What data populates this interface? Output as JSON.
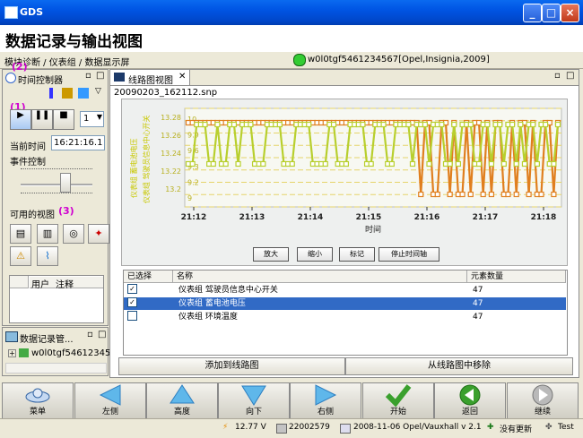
{
  "window": {
    "title": "GDS",
    "minimize": "_",
    "maximize": "□",
    "close": "×"
  },
  "app": {
    "title": "数据记录与输出视图",
    "breadcrumb": "模块诊断 / 仪表组 / 数据显示屏",
    "vehicle": "w0l0tgf5461234567[Opel,Insignia,2009]"
  },
  "timer_panel": {
    "tab_label": "时间控制器",
    "callout_1": "(1)",
    "callout_2": "(2)",
    "callout_3": "(3)",
    "speed_value": "1",
    "current_time_label": "当前时间",
    "current_time_value": "16:21:16.1",
    "event_control_label": "事件控制",
    "views_label": "可用的视图",
    "table_headers": [
      "用户",
      "注释"
    ]
  },
  "data_panel": {
    "tab_label": "数据记录管...",
    "tree_item": "w0l0tgf546123456"
  },
  "graph_view": {
    "tab_label": "线路图视图",
    "file_name": "20090203_162112.snp",
    "buttons": [
      "放大",
      "缩小",
      "标记",
      "停止时间轴"
    ],
    "add_button": "添加到线路图",
    "remove_button": "从线路图中移除"
  },
  "chart_data": {
    "type": "line",
    "xlabel": "时间",
    "x_ticks": [
      "21:12",
      "21:13",
      "21:14",
      "21:15",
      "21:16",
      "21:17",
      "21:18"
    ],
    "left_axis_label": "仪表组 蓄电池电压",
    "right_axis_label": "仪表组 驾驶员信息中心开关",
    "y_ticks_voltage": [
      "13.28",
      "13.26",
      "13.24",
      "13.22",
      "13.2"
    ],
    "y_ticks_switch": [
      "10",
      "9.9",
      "9.6",
      "9.3",
      "9.2",
      "9"
    ],
    "series": [
      {
        "color": "#E07F1F",
        "values": [
          1,
          1,
          1,
          1,
          1,
          1,
          1,
          1,
          1,
          1,
          1,
          1,
          1,
          1,
          1,
          1,
          1,
          1,
          1,
          1,
          1,
          1,
          1,
          1,
          1,
          1,
          1,
          1,
          1,
          1,
          1,
          1,
          1,
          1,
          1,
          1,
          1,
          1,
          1,
          1,
          1,
          1,
          1,
          1,
          1,
          1,
          1,
          1,
          1,
          1,
          1,
          1,
          1,
          1,
          1,
          1,
          0,
          1,
          1,
          0,
          0,
          1,
          1,
          0,
          1,
          0,
          0,
          1,
          0,
          1,
          1,
          0,
          1,
          0,
          1,
          1,
          0,
          0,
          1,
          0,
          1,
          1,
          0,
          1,
          0,
          0,
          1,
          1,
          0,
          1
        ]
      },
      {
        "color": "#B8CF2E",
        "values": [
          0.45,
          0.45,
          1,
          1,
          1,
          0.45,
          0.45,
          1,
          0.45,
          0.45,
          1,
          1,
          0.45,
          1,
          1,
          1,
          0.45,
          0.45,
          0.45,
          1,
          1,
          1,
          1,
          0.45,
          0.45,
          0.45,
          1,
          1,
          1,
          1,
          0.45,
          0.45,
          0.45,
          0.45,
          1,
          1,
          0.45,
          0.45,
          0.45,
          1,
          1,
          1,
          1,
          0.45,
          0.45,
          1,
          1,
          1,
          0.45,
          0.45,
          1,
          1,
          1,
          1,
          0.45,
          1,
          1,
          1,
          0.45,
          1,
          1,
          1,
          0.45,
          0.45,
          1,
          0.45,
          1,
          1,
          1,
          0.45,
          0.45,
          1,
          1,
          0.45,
          1,
          1,
          0.45,
          1,
          1,
          0.45,
          1,
          0.45,
          1,
          1,
          0.45,
          1,
          1,
          0.45,
          0.45,
          1
        ]
      }
    ]
  },
  "table": {
    "headers": [
      "已选择",
      "名称",
      "元素数量"
    ],
    "rows": [
      {
        "checked": "✓",
        "name": "仪表组 驾驶员信息中心开关",
        "count": "47"
      },
      {
        "checked": "✓",
        "name": "仪表组 蓄电池电压",
        "count": "47"
      },
      {
        "checked": "",
        "name": "仪表组 环境温度",
        "count": "47"
      }
    ]
  },
  "toolbar": [
    "菜单",
    "左侧",
    "高度",
    "向下",
    "右侧",
    "开始",
    "返回",
    "继续"
  ],
  "status": {
    "voltage": "12.77 V",
    "id": "22002579",
    "version": "2008-11-06 Opel/Vauxhall v 2.1",
    "update": "没有更新",
    "mode": "Test"
  },
  "colors": {
    "title_blue": "#0054E3",
    "selected_row": "#316AC5",
    "orange": "#E07F1F",
    "yellow": "#B8CF2E"
  }
}
